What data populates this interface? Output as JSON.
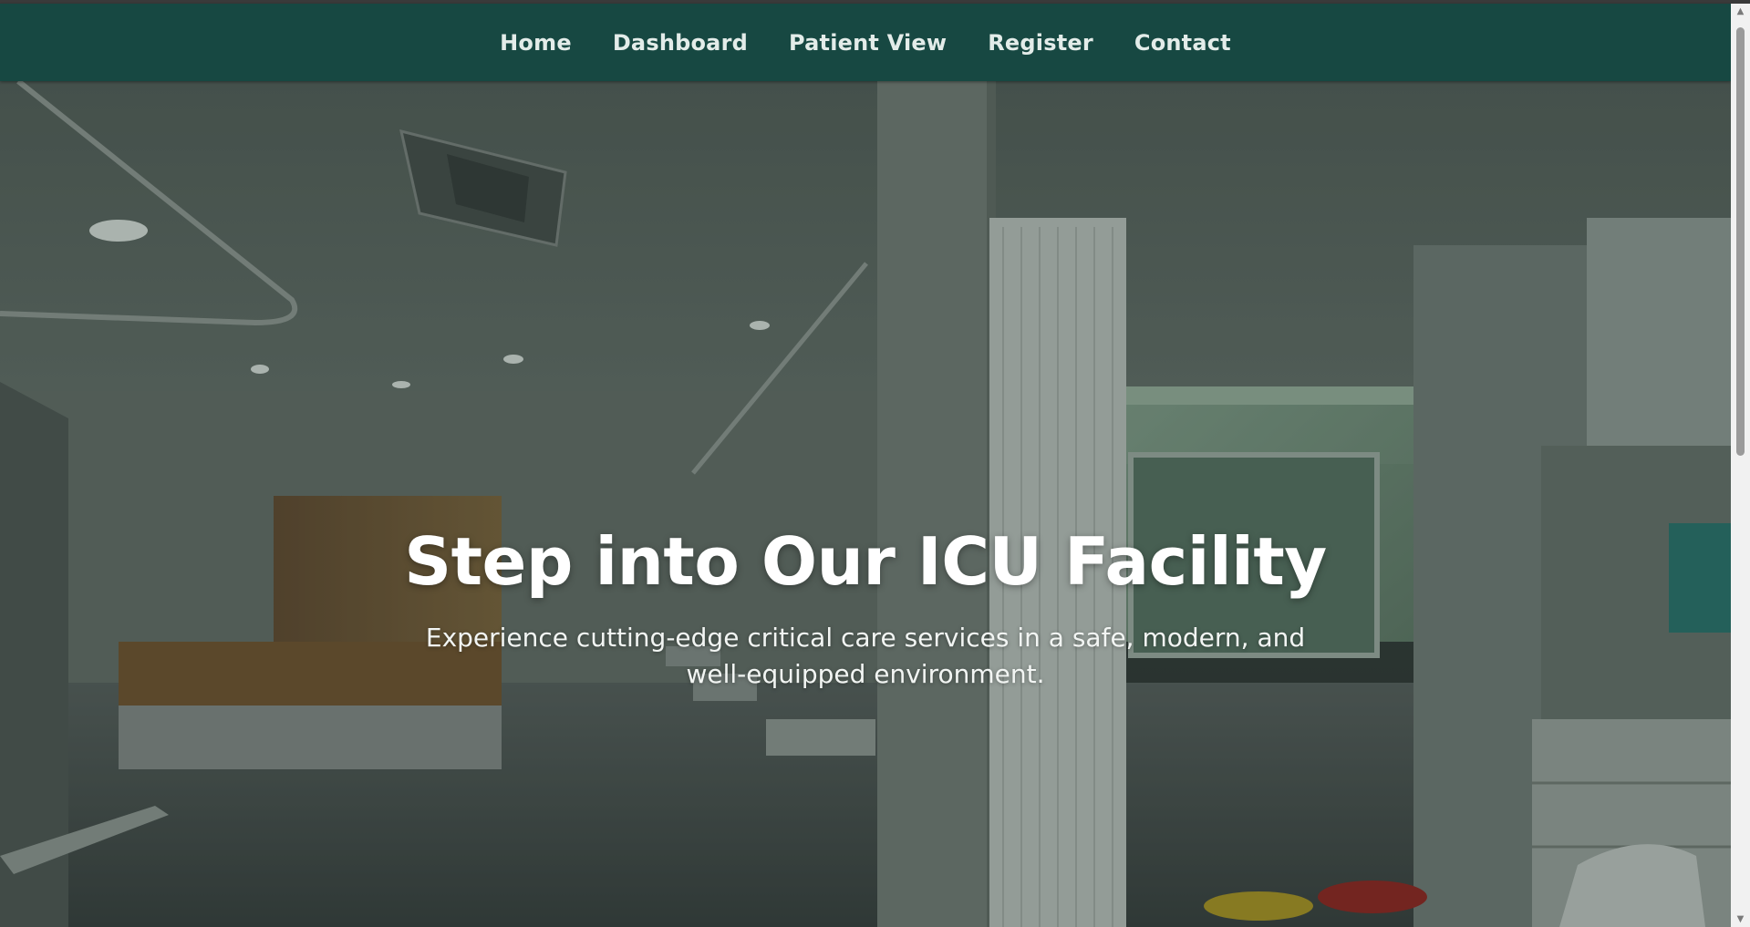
{
  "nav": {
    "items": [
      {
        "label": "Home"
      },
      {
        "label": "Dashboard"
      },
      {
        "label": "Patient View"
      },
      {
        "label": "Register"
      },
      {
        "label": "Contact"
      }
    ]
  },
  "hero": {
    "title": "Step into Our ICU Facility",
    "subtitle": "Experience cutting-edge critical care services in a safe, modern, and well-equipped environment.",
    "background_image": "icu-room-photo"
  },
  "scrollbar": {
    "up_icon": "arrow-up-icon",
    "down_icon": "arrow-down-icon"
  },
  "colors": {
    "navbar": "#174842",
    "nav_text": "#e3ece9",
    "hero_text": "#ffffff"
  }
}
